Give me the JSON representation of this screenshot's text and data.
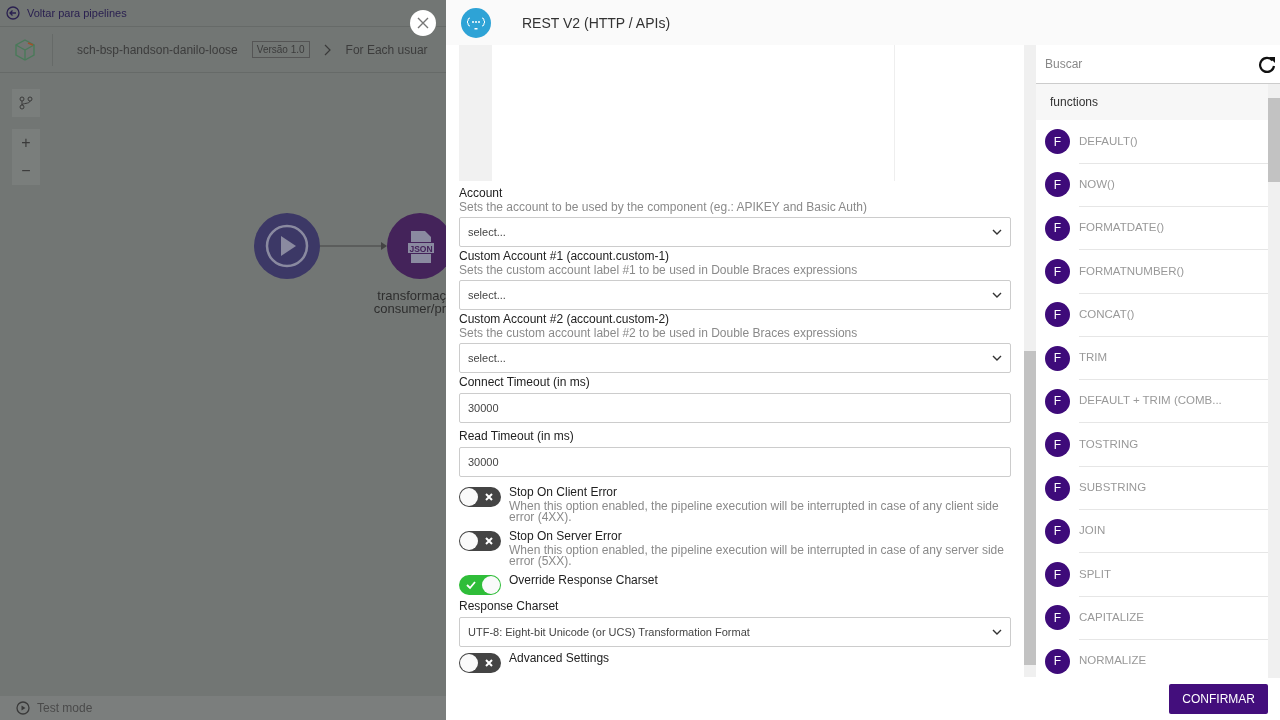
{
  "app": {
    "back_link": "Voltar para pipelines",
    "pipeline_name": "sch-bsp-handson-danilo-loose",
    "version": "Versão 1.0",
    "breadcrumb": "For Each usuar",
    "zoom_controls": [
      "+",
      "−"
    ],
    "nodes": [
      {
        "kind": "trigger"
      },
      {
        "kind": "json",
        "badge_text": "JSON",
        "label_lines": [
          "transformaç",
          "consumer/pr"
        ]
      }
    ],
    "test_mode": "Test mode"
  },
  "dialog": {
    "title": "REST V2 (HTTP / APIs)",
    "fields": [
      {
        "kind": "select",
        "label": "Account",
        "description": "Sets the account to be used by the component (eg.: APIKEY and Basic Auth)",
        "value": "select..."
      },
      {
        "kind": "select",
        "label": "Custom Account #1 (account.custom-1)",
        "description": "Sets the custom account label #1 to be used in Double Braces expressions",
        "value": "select..."
      },
      {
        "kind": "select",
        "label": "Custom Account #2 (account.custom-2)",
        "description": "Sets the custom account label #2 to be used in Double Braces expressions",
        "value": "select..."
      },
      {
        "kind": "input",
        "label": "Connect Timeout (in ms)",
        "value": "30000"
      },
      {
        "kind": "input",
        "label": "Read Timeout (in ms)",
        "value": "30000"
      },
      {
        "kind": "toggle",
        "label": "Stop On Client Error",
        "description": "When this option enabled, the pipeline execution will be interrupted in case of any client side error (4XX).",
        "on": false
      },
      {
        "kind": "toggle",
        "label": "Stop On Server Error",
        "description": "When this option enabled, the pipeline execution will be interrupted in case of any server side error (5XX).",
        "on": false
      },
      {
        "kind": "toggle",
        "label": "Override Response Charset",
        "on": true
      },
      {
        "kind": "select",
        "label": "Response Charset",
        "value": "UTF-8: Eight-bit Unicode (or UCS) Transformation Format"
      },
      {
        "kind": "toggle",
        "label": "Advanced Settings",
        "on": false
      }
    ],
    "search": {
      "placeholder": "Buscar"
    },
    "section": "functions",
    "functions": [
      {
        "badge": "F",
        "name": "DEFAULT()"
      },
      {
        "badge": "F",
        "name": "NOW()"
      },
      {
        "badge": "F",
        "name": "FORMATDATE()"
      },
      {
        "badge": "F",
        "name": "FORMATNUMBER()"
      },
      {
        "badge": "F",
        "name": "CONCAT()"
      },
      {
        "badge": "F",
        "name": "TRIM"
      },
      {
        "badge": "F",
        "name": "DEFAULT + TRIM (COMB..."
      },
      {
        "badge": "F",
        "name": "TOSTRING"
      },
      {
        "badge": "F",
        "name": "SUBSTRING"
      },
      {
        "badge": "F",
        "name": "JOIN"
      },
      {
        "badge": "F",
        "name": "SPLIT"
      },
      {
        "badge": "F",
        "name": "CAPITALIZE"
      },
      {
        "badge": "F",
        "name": "NORMALIZE"
      }
    ],
    "confirm_button": "CONFIRMAR"
  }
}
